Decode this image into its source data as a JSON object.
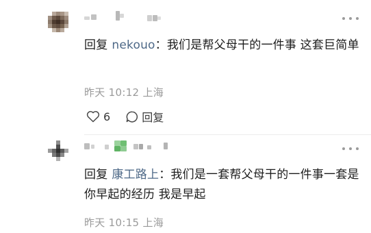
{
  "comments": [
    {
      "reply_prefix": "回复",
      "reply_target": "nekouo",
      "text": "：我们是帮父母干的一件事 这套巨简单",
      "meta": "昨天 10:12 上海",
      "likes": "6",
      "reply_button": "回复"
    },
    {
      "reply_prefix": "回复",
      "reply_target": "康工路上",
      "text": "：我们是一套帮父母干的一件事一套是你早起的经历 我是早起",
      "meta": "昨天 10:15 上海"
    }
  ],
  "colors": {
    "reply_target": "#4d6887",
    "meta": "#9a9a9a",
    "text": "#1c1c1c"
  }
}
